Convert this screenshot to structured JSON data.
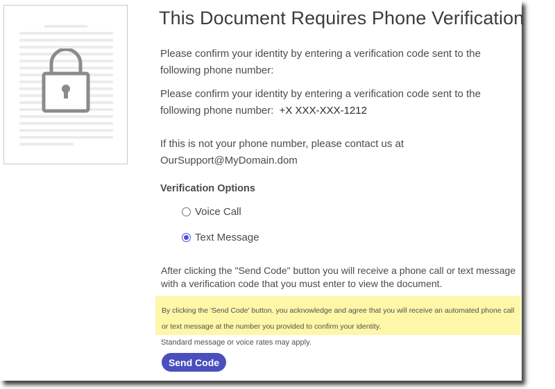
{
  "page": {
    "title": "This Document Requires Phone Verification",
    "intro_text": "Please confirm your identity by entering a verification code sent to the following phone number:",
    "confirm_text": "Please confirm your identity by entering a verification code sent to the following phone number:",
    "phone_number": "+X XXX-XXX-1212",
    "contact_text": "If this is not your phone number, please contact us at OurSupport@MyDomain.dom"
  },
  "verification": {
    "section_label": "Verification Options",
    "options": [
      {
        "label": "Voice Call",
        "selected": false
      },
      {
        "label": "Text Message",
        "selected": true
      }
    ]
  },
  "instructions": "After clicking the \"Send Code\" button you will receive a phone call or text message with a verification code that you must enter to view the document.",
  "notice": {
    "text": "By clicking the 'Send Code' button. you acknowledge and agree that you will receive an automated phone call or text message at the number you provided to confirm your identity.",
    "background_color": "#fdf7a7"
  },
  "rates_text": "Standard message or voice rates may apply.",
  "send_button": {
    "label": "Send Code",
    "color": "#4a4fbd"
  },
  "icons": {
    "document": "document-thumbnail-icon",
    "lock": "padlock-icon"
  }
}
